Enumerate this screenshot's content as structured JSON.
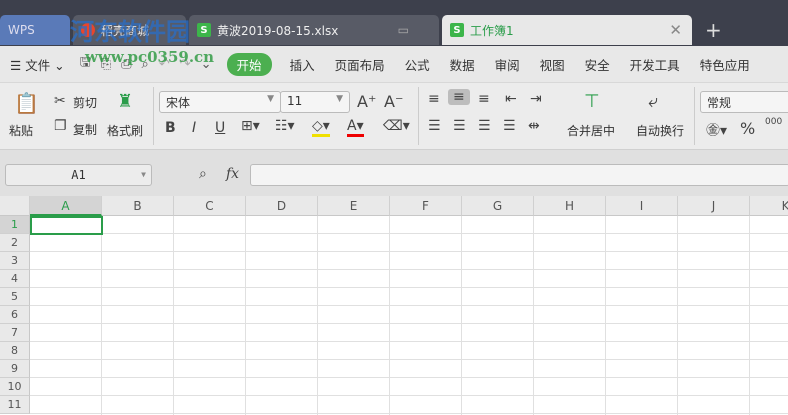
{
  "watermark": {
    "title": "河东软件园",
    "url": "www.pc0359.cn"
  },
  "tabs": [
    {
      "label": "WPS"
    },
    {
      "label": "稻壳商城"
    },
    {
      "label": "黄波2019-08-15.xlsx"
    },
    {
      "label": "工作簿1",
      "active": true
    }
  ],
  "menu": {
    "file": "文件",
    "items": [
      "开始",
      "插入",
      "页面布局",
      "公式",
      "数据",
      "审阅",
      "视图",
      "安全",
      "开发工具",
      "特色应用"
    ]
  },
  "ribbon": {
    "paste": "粘贴",
    "cut": "剪切",
    "copy": "复制",
    "format_painter": "格式刷",
    "font": "宋体",
    "font_size": "11",
    "merge_center": "合并居中",
    "wrap_text": "自动换行",
    "number_format": "常规",
    "percent": "%",
    "thousands": "000"
  },
  "formula_bar": {
    "cell_ref": "A1",
    "fx": "fx",
    "value": ""
  },
  "columns": [
    "A",
    "B",
    "C",
    "D",
    "E",
    "F",
    "G",
    "H",
    "I",
    "J",
    "K"
  ],
  "rows": [
    "1",
    "2",
    "3",
    "4",
    "5",
    "6",
    "7",
    "8",
    "9",
    "10",
    "11"
  ],
  "colors": {
    "accent": "#4caf50",
    "titlebar": "#3d404c"
  }
}
